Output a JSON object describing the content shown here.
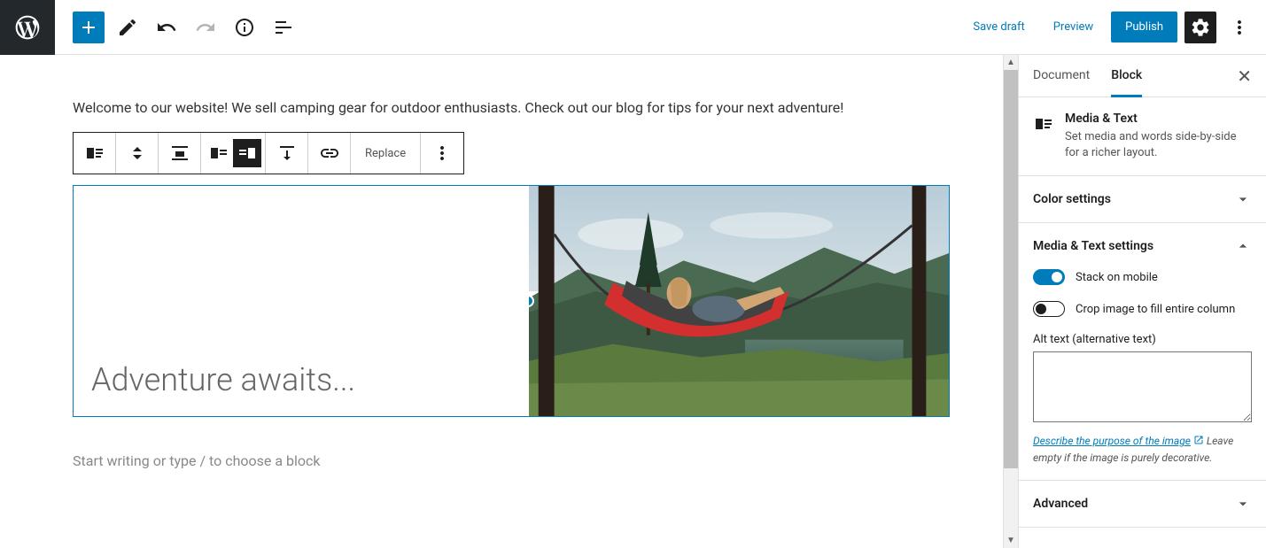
{
  "topbar": {
    "save_draft": "Save draft",
    "preview": "Preview",
    "publish": "Publish"
  },
  "editor": {
    "intro_text": "Welcome to our website! We sell camping gear for outdoor enthusiasts. Check out our blog for tips for your next adventure!",
    "block_heading": "Adventure awaits...",
    "toolbar_replace": "Replace",
    "placeholder": "Start writing or type / to choose a block"
  },
  "sidebar": {
    "tabs": {
      "document": "Document",
      "block": "Block"
    },
    "block_info": {
      "title": "Media & Text",
      "desc": "Set media and words side-by-side for a richer layout."
    },
    "panels": {
      "color_settings": "Color settings",
      "media_text_settings": "Media & Text settings",
      "advanced": "Advanced"
    },
    "settings": {
      "stack_mobile": "Stack on mobile",
      "crop_fill": "Crop image to fill entire column",
      "alt_label": "Alt text (alternative text)",
      "alt_help_link": "Describe the purpose of the image",
      "alt_help_rest": " Leave empty if the image is purely decorative."
    }
  }
}
